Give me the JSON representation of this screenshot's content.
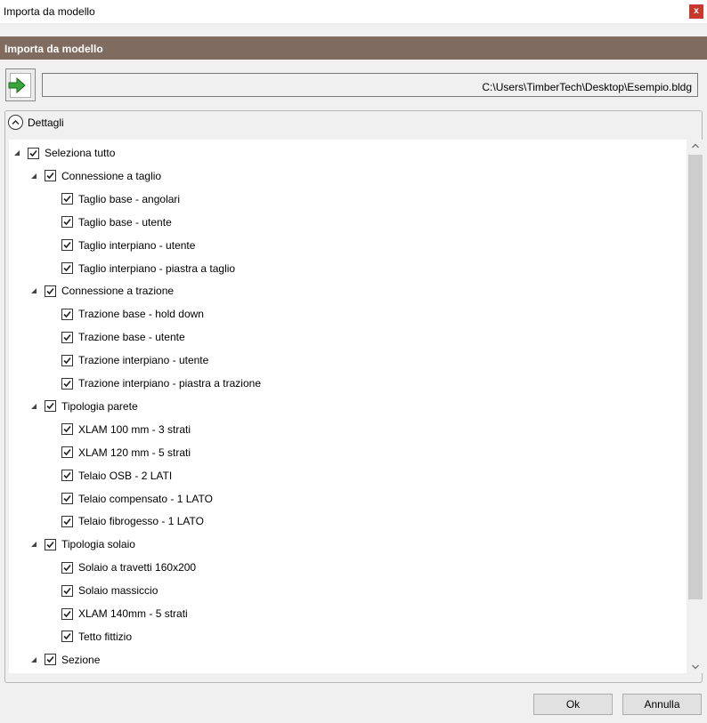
{
  "window": {
    "title": "Importa da modello",
    "close_label": "x"
  },
  "header": {
    "title": "Importa da modello"
  },
  "file": {
    "path": "C:\\Users\\TimberTech\\Desktop\\Esempio.bldg",
    "import_icon": "import-file-icon"
  },
  "details": {
    "label": "Dettagli",
    "tree": [
      {
        "label": "Seleziona tutto",
        "level": 0,
        "expandable": true,
        "checked": true
      },
      {
        "label": "Connessione a taglio",
        "level": 1,
        "expandable": true,
        "checked": true
      },
      {
        "label": "Taglio base - angolari",
        "level": 2,
        "expandable": false,
        "checked": true
      },
      {
        "label": "Taglio base - utente",
        "level": 2,
        "expandable": false,
        "checked": true
      },
      {
        "label": "Taglio interpiano - utente",
        "level": 2,
        "expandable": false,
        "checked": true
      },
      {
        "label": "Taglio interpiano - piastra a taglio",
        "level": 2,
        "expandable": false,
        "checked": true
      },
      {
        "label": "Connessione a trazione",
        "level": 1,
        "expandable": true,
        "checked": true
      },
      {
        "label": "Trazione base - hold down",
        "level": 2,
        "expandable": false,
        "checked": true
      },
      {
        "label": "Trazione base - utente",
        "level": 2,
        "expandable": false,
        "checked": true
      },
      {
        "label": "Trazione interpiano - utente",
        "level": 2,
        "expandable": false,
        "checked": true
      },
      {
        "label": "Trazione interpiano - piastra a trazione",
        "level": 2,
        "expandable": false,
        "checked": true
      },
      {
        "label": "Tipologia parete",
        "level": 1,
        "expandable": true,
        "checked": true
      },
      {
        "label": "XLAM 100 mm - 3 strati",
        "level": 2,
        "expandable": false,
        "checked": true
      },
      {
        "label": "XLAM 120 mm - 5 strati",
        "level": 2,
        "expandable": false,
        "checked": true
      },
      {
        "label": "Telaio OSB - 2 LATI",
        "level": 2,
        "expandable": false,
        "checked": true
      },
      {
        "label": "Telaio compensato - 1 LATO",
        "level": 2,
        "expandable": false,
        "checked": true
      },
      {
        "label": "Telaio fibrogesso - 1 LATO",
        "level": 2,
        "expandable": false,
        "checked": true
      },
      {
        "label": "Tipologia solaio",
        "level": 1,
        "expandable": true,
        "checked": true
      },
      {
        "label": "Solaio a travetti 160x200",
        "level": 2,
        "expandable": false,
        "checked": true
      },
      {
        "label": "Solaio massiccio",
        "level": 2,
        "expandable": false,
        "checked": true
      },
      {
        "label": "XLAM 140mm - 5 strati",
        "level": 2,
        "expandable": false,
        "checked": true
      },
      {
        "label": "Tetto fittizio",
        "level": 2,
        "expandable": false,
        "checked": true
      },
      {
        "label": "Sezione",
        "level": 1,
        "expandable": true,
        "checked": true
      }
    ]
  },
  "buttons": {
    "ok": "Ok",
    "cancel": "Annulla"
  },
  "colors": {
    "header_band": "#7f6b5f",
    "close": "#c8392d",
    "arrow": "#3aa53a"
  }
}
